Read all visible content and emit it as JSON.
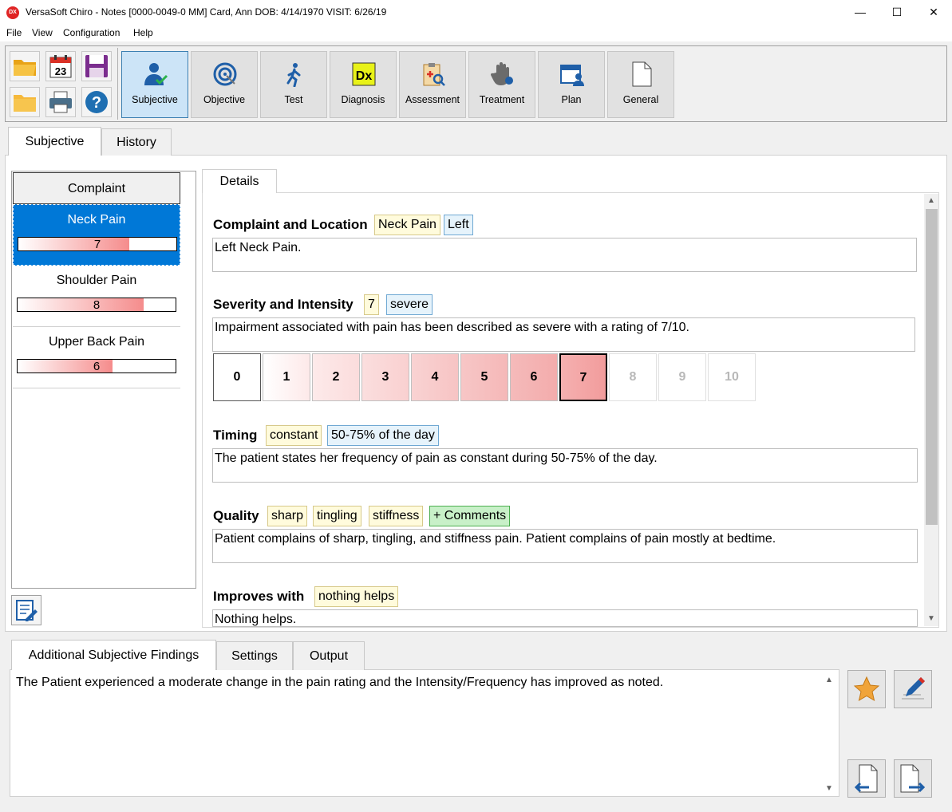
{
  "window": {
    "title": "VersaSoft Chiro - Notes [0000-0049-0 MM]   Card, Ann   DOB: 4/14/1970   VISIT: 6/26/19",
    "icon_text": "DX",
    "minimize": "—",
    "maximize": "☐",
    "close": "✕"
  },
  "menu": [
    {
      "label": "File"
    },
    {
      "label": "View"
    },
    {
      "label": "Configuration"
    },
    {
      "label": "Help"
    }
  ],
  "toolbar": {
    "calendar_day": "23",
    "help_glyph": "?",
    "dx_label": "Dx",
    "tools": [
      {
        "label": "Subjective",
        "icon": "person-check-icon",
        "active": true
      },
      {
        "label": "Objective",
        "icon": "target-icon"
      },
      {
        "label": "Test",
        "icon": "walking-icon"
      },
      {
        "label": "Diagnosis",
        "icon": "dx-icon"
      },
      {
        "label": "Assessment",
        "icon": "clipboard-search-icon"
      },
      {
        "label": "Treatment",
        "icon": "hand-icon"
      },
      {
        "label": "Plan",
        "icon": "calendar-person-icon"
      },
      {
        "label": "General",
        "icon": "document-icon"
      }
    ]
  },
  "main_tabs": [
    {
      "label": "Subjective",
      "selected": true
    },
    {
      "label": "History"
    }
  ],
  "complaints": {
    "header": "Complaint",
    "items": [
      {
        "name": "Neck Pain",
        "rating": "7",
        "fill": 0.7,
        "selected": true
      },
      {
        "name": "Shoulder Pain",
        "rating": "8",
        "fill": 0.8
      },
      {
        "name": "Upper Back Pain",
        "rating": "6",
        "fill": 0.6
      }
    ]
  },
  "details": {
    "tab_label": "Details",
    "sections": [
      {
        "title": "Complaint and Location",
        "chips": [
          {
            "text": "Neck Pain",
            "style": "y"
          },
          {
            "text": "Left",
            "style": "b"
          }
        ],
        "text": "Left Neck Pain."
      },
      {
        "title": "Severity and Intensity",
        "chips": [
          {
            "text": "7",
            "style": "y"
          },
          {
            "text": "severe",
            "style": "b"
          }
        ],
        "text": "Impairment associated with pain has been described as severe with a rating of 7/10."
      },
      {
        "title": "Timing",
        "chips": [
          {
            "text": "constant",
            "style": "y"
          },
          {
            "text": "50-75% of the day",
            "style": "b"
          }
        ],
        "text": "The patient states her frequency of pain as constant during 50-75% of the day."
      },
      {
        "title": "Quality",
        "chips": [
          {
            "text": "sharp",
            "style": "y"
          },
          {
            "text": "tingling",
            "style": "y"
          },
          {
            "text": "stiffness",
            "style": "y"
          },
          {
            "text": "+ Comments",
            "style": "g"
          }
        ],
        "text": "Patient complains of sharp, tingling, and stiffness pain.  Patient complains of pain mostly at bedtime."
      },
      {
        "title": "Improves with",
        "chips": [
          {
            "text": "nothing helps",
            "style": "y"
          }
        ],
        "text": "Nothing helps."
      }
    ],
    "scale": {
      "values": [
        "0",
        "1",
        "2",
        "3",
        "4",
        "5",
        "6",
        "7",
        "8",
        "9",
        "10"
      ],
      "selected": "7"
    }
  },
  "bottom_tabs": [
    {
      "label": "Additional Subjective Findings",
      "selected": true
    },
    {
      "label": "Settings"
    },
    {
      "label": "Output"
    }
  ],
  "findings_text": "The Patient experienced a moderate change in the pain rating and the Intensity/Frequency has improved as noted.",
  "colors": {
    "selection_blue": "#0078d7",
    "active_tool": "#cce4f7",
    "chip_yellow": "#fffbdc",
    "chip_blue": "#e6f3fb",
    "chip_green": "#c8f0c8",
    "pain_red": "#f58c8c"
  }
}
